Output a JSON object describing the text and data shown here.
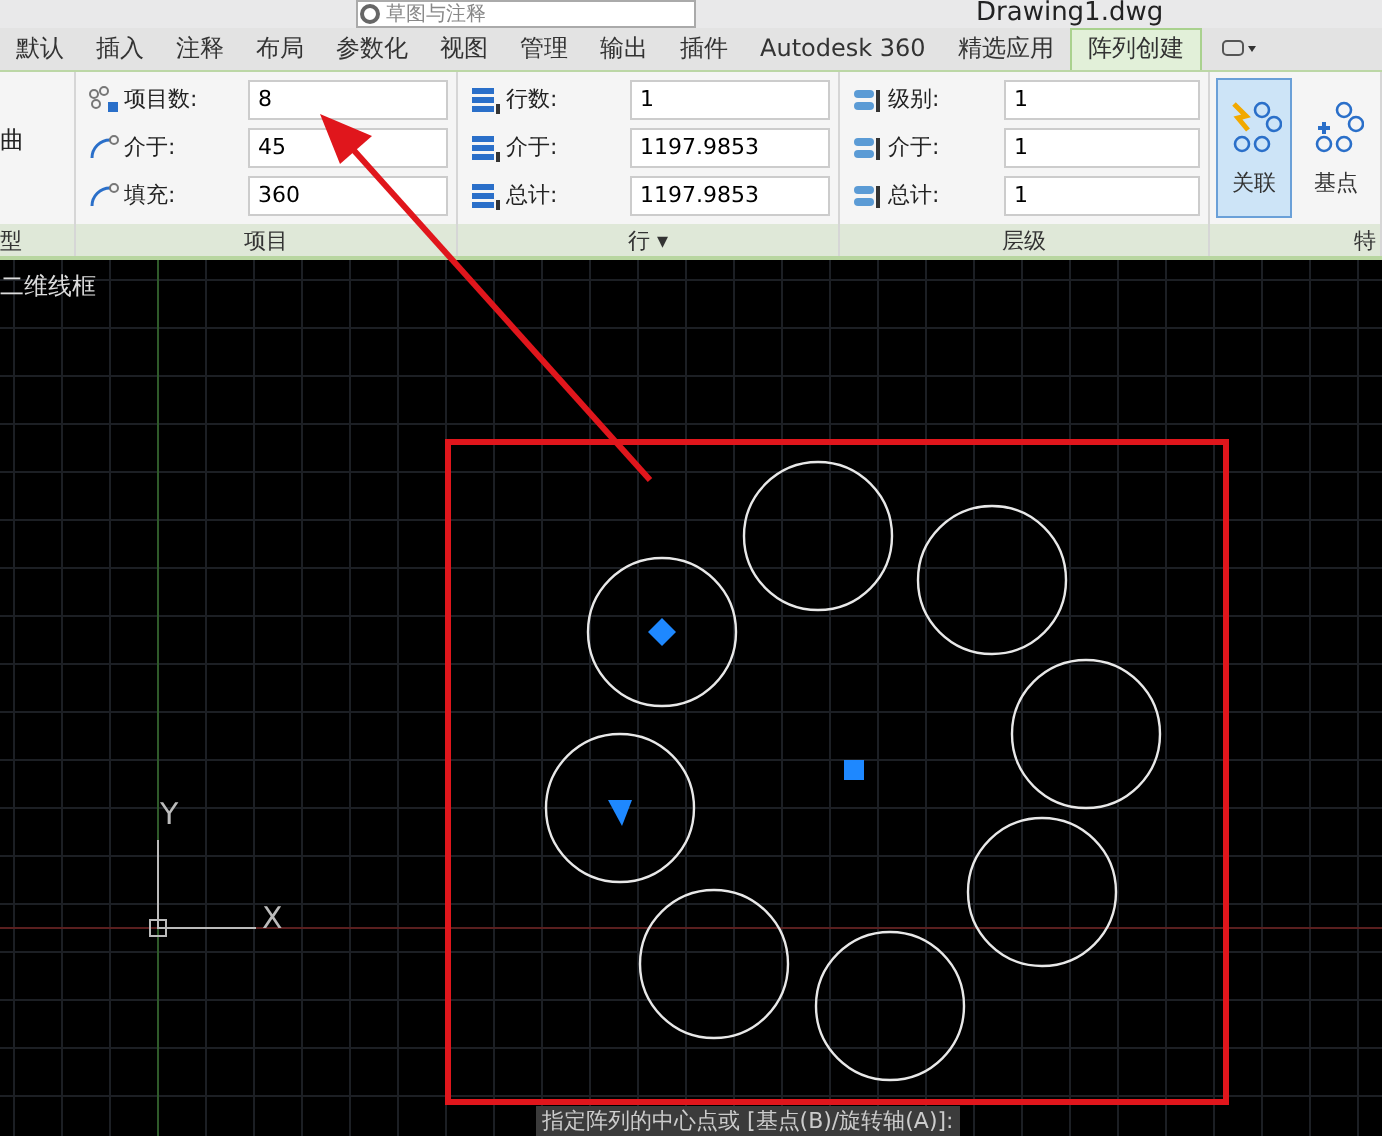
{
  "title_bar": {
    "workspace": "草图与注释",
    "document": "Drawing1.dwg"
  },
  "tabs": [
    {
      "label": "默认",
      "selected": false
    },
    {
      "label": "插入",
      "selected": false
    },
    {
      "label": "注释",
      "selected": false
    },
    {
      "label": "布局",
      "selected": false
    },
    {
      "label": "参数化",
      "selected": false
    },
    {
      "label": "视图",
      "selected": false
    },
    {
      "label": "管理",
      "selected": false
    },
    {
      "label": "输出",
      "selected": false
    },
    {
      "label": "插件",
      "selected": false
    },
    {
      "label": "Autodesk 360",
      "selected": false
    },
    {
      "label": "精选应用",
      "selected": false
    },
    {
      "label": "阵列创建",
      "selected": true
    }
  ],
  "ribbon": {
    "partial_panel": {
      "label": "曲",
      "title": "型"
    },
    "panels": [
      {
        "kind": "items",
        "title": "项目",
        "fields": [
          {
            "label": "项目数:",
            "value": "8"
          },
          {
            "label": "介于:",
            "value": "45"
          },
          {
            "label": "填充:",
            "value": "360"
          }
        ]
      },
      {
        "kind": "rows",
        "title": "行 ▾",
        "fields": [
          {
            "label": "行数:",
            "value": "1"
          },
          {
            "label": "介于:",
            "value": "1197.9853"
          },
          {
            "label": "总计:",
            "value": "1197.9853"
          }
        ]
      },
      {
        "kind": "levels",
        "title": "层级",
        "fields": [
          {
            "label": "级别:",
            "value": "1"
          },
          {
            "label": "介于:",
            "value": "1"
          },
          {
            "label": "总计:",
            "value": "1"
          }
        ]
      }
    ],
    "properties": {
      "title": "特",
      "buttons": [
        {
          "label": "关联",
          "selected": true
        },
        {
          "label": "基点",
          "selected": false
        }
      ]
    }
  },
  "viewport": {
    "visual_style": "二维线框",
    "ucs": {
      "y_label": "Y",
      "x_label": "X"
    }
  },
  "command_line": "指定阵列的中心点或 [基点(B)/旋转轴(A)]:"
}
